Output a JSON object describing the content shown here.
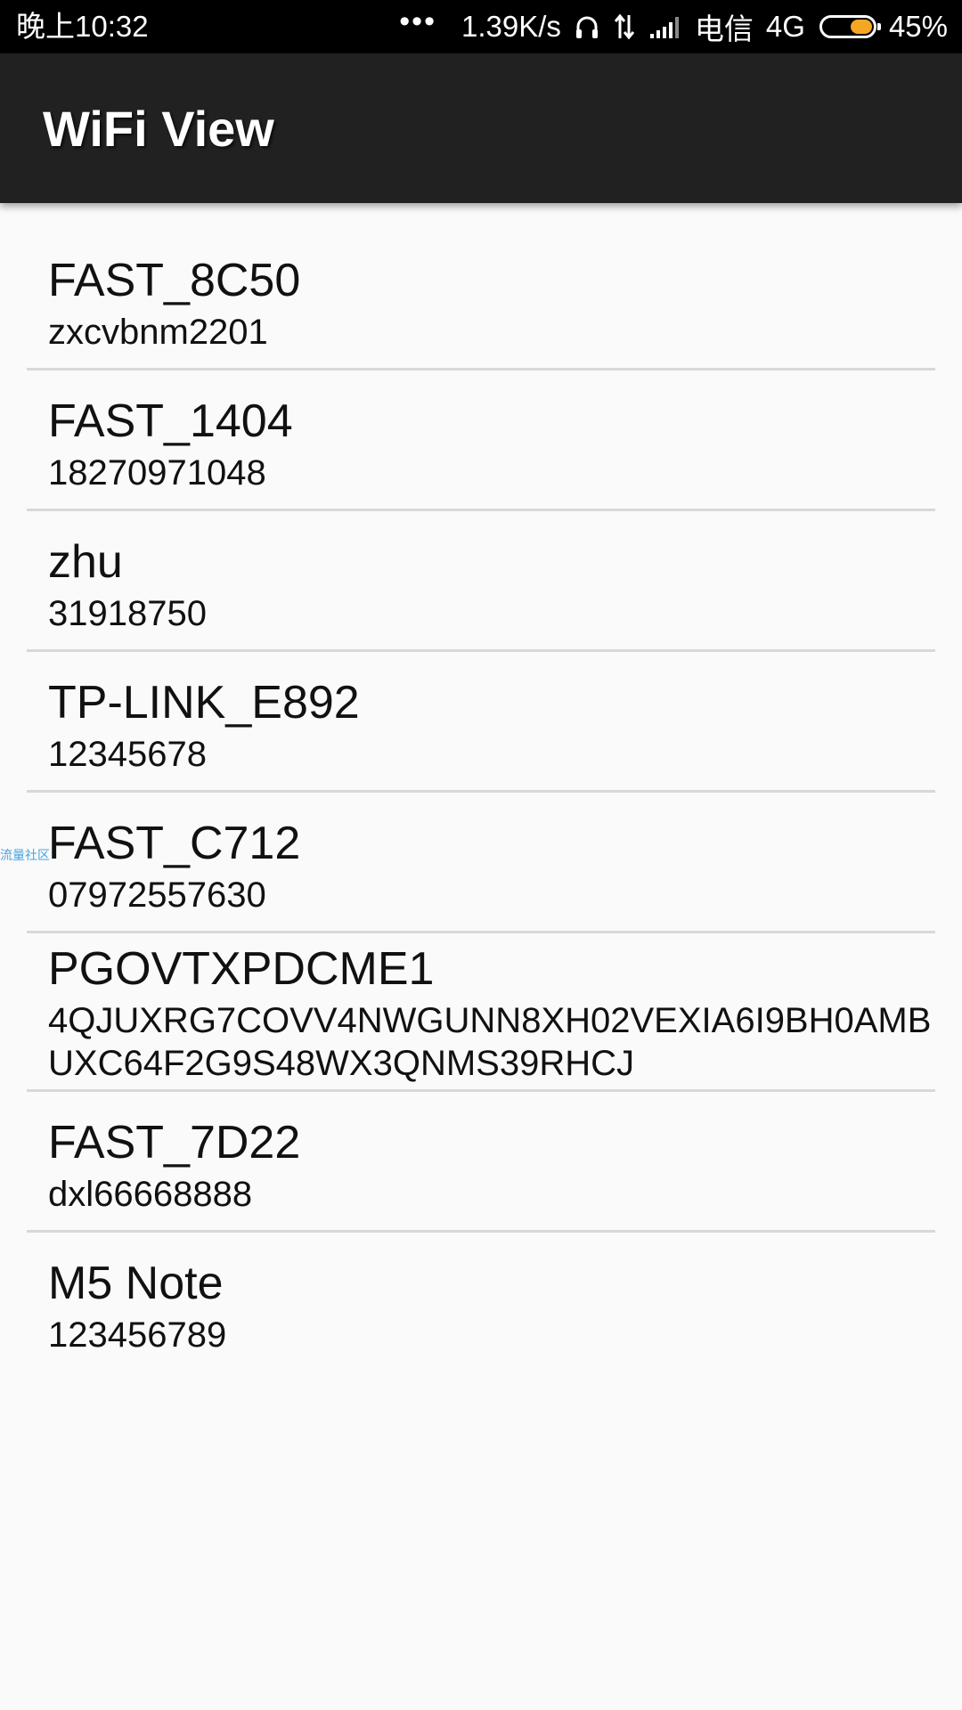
{
  "status_bar": {
    "time": "晚上10:32",
    "dots": "•••",
    "speed": "1.39K/s",
    "carrier": "电信",
    "network": "4G",
    "battery": "45%",
    "battery_level": 0.45,
    "battery_color": "#f5a623",
    "icons": [
      "headphones-icon",
      "data-arrows-icon",
      "signal-icon",
      "battery-icon"
    ]
  },
  "app_bar": {
    "title": "WiFi View"
  },
  "watermark": "流量社区",
  "wifi_list": [
    {
      "ssid": "FAST_8C50",
      "password": "zxcvbnm2201"
    },
    {
      "ssid": "FAST_1404",
      "password": "18270971048"
    },
    {
      "ssid": "zhu",
      "password": "31918750"
    },
    {
      "ssid": "TP-LINK_E892",
      "password": "12345678"
    },
    {
      "ssid": "FAST_C712",
      "password": "07972557630"
    },
    {
      "ssid": "PGOVTXPDCME1",
      "password": "4QJUXRG7COVV4NWGUNN8XH02VEXIA6I9BH0AMBUXC64F2G9S48WX3QNMS39RHCJ"
    },
    {
      "ssid": "FAST_7D22",
      "password": "dxl66668888"
    },
    {
      "ssid": "M5 Note",
      "password": "123456789"
    }
  ]
}
